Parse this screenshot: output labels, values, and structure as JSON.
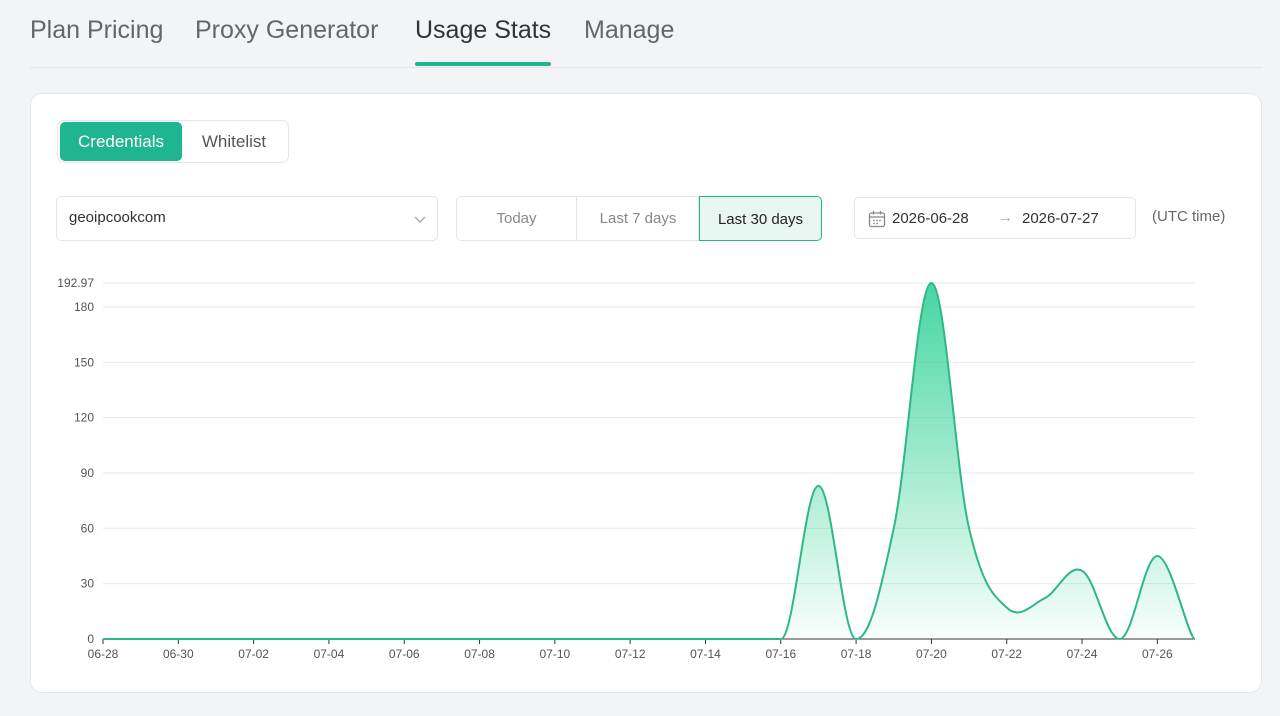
{
  "tabs": [
    {
      "label": "Plan Pricing",
      "active": false
    },
    {
      "label": "Proxy Generator",
      "active": false
    },
    {
      "label": "Usage Stats",
      "active": true
    },
    {
      "label": "Manage",
      "active": false
    }
  ],
  "mode_toggle": {
    "credentials": "Credentials",
    "whitelist": "Whitelist",
    "selected": "Credentials"
  },
  "account_select": {
    "value": "geoipcookcom",
    "icon": "chevron-down-icon"
  },
  "range_buttons": {
    "today": "Today",
    "last7": "Last 7 days",
    "last30": "Last 30 days",
    "selected": "Last 30 days"
  },
  "date_range": {
    "start": "2026-06-28",
    "arrow": "→",
    "end": "2026-07-27",
    "icon": "calendar-icon"
  },
  "timezone_note": "(UTC time)",
  "colors": {
    "accent": "#1fb58f",
    "line": "#2eb883",
    "area_top": "#3dd49d"
  },
  "chart_data": {
    "type": "area",
    "x": [
      "06-28",
      "06-29",
      "06-30",
      "07-01",
      "07-02",
      "07-03",
      "07-04",
      "07-05",
      "07-06",
      "07-07",
      "07-08",
      "07-09",
      "07-10",
      "07-11",
      "07-12",
      "07-13",
      "07-14",
      "07-15",
      "07-16",
      "07-17",
      "07-18",
      "07-19",
      "07-20",
      "07-21",
      "07-22",
      "07-23",
      "07-24",
      "07-25",
      "07-26",
      "07-27"
    ],
    "values": [
      0,
      0,
      0,
      0,
      0,
      0,
      0,
      0,
      0,
      0,
      0,
      0,
      0,
      0,
      0,
      0,
      0,
      0,
      0,
      83,
      0,
      60,
      192.97,
      60,
      17,
      22,
      37,
      0,
      45,
      0
    ],
    "x_ticks": [
      "06-28",
      "06-30",
      "07-02",
      "07-04",
      "07-06",
      "07-08",
      "07-10",
      "07-12",
      "07-14",
      "07-16",
      "07-18",
      "07-20",
      "07-22",
      "07-24",
      "07-26"
    ],
    "y_ticks": [
      0,
      30,
      60,
      90,
      120,
      150,
      180
    ],
    "y_max_label": "192.97",
    "ylim": [
      0,
      192.97
    ],
    "grid": true,
    "title": "",
    "xlabel": "",
    "ylabel": ""
  }
}
